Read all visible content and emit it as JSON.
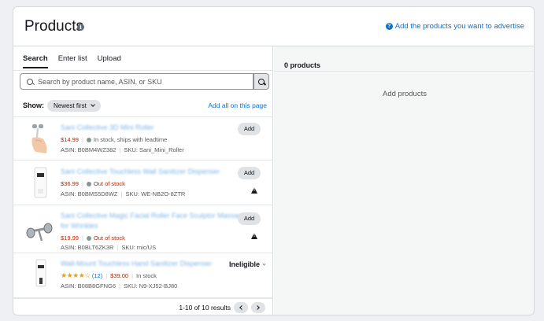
{
  "header": {
    "title": "Products",
    "help_link": "Add the products you want to advertise"
  },
  "tabs": [
    {
      "label": "Search",
      "active": true
    },
    {
      "label": "Enter list",
      "active": false
    },
    {
      "label": "Upload",
      "active": false
    }
  ],
  "search": {
    "placeholder": "Search by product name, ASIN, or SKU"
  },
  "filter": {
    "show_label": "Show:",
    "sort_value": "Newest first",
    "add_all": "Add all on this page"
  },
  "products": [
    {
      "name": "Sani Collective 3D Mini Roller",
      "price": "$14.99",
      "status": "In stock, ships with leadtime",
      "asin": "ASIN: B0BM4WZ382",
      "sku": "SKU: Sani_Mini_Roller",
      "action": "Add"
    },
    {
      "name": "Sani Collective Touchless Wall Sanitizer Dispenser",
      "price": "$36.99",
      "status": "Out of stock",
      "asin": "ASIN: B0BMS5D8WZ",
      "sku": "SKU: WE-NB2O-8ZTR",
      "action": "Add"
    },
    {
      "name": "Sani Collective Magic Facial Roller Face Sculptor Massage for Wrinkles",
      "price": "$19.99",
      "status": "Out of stock",
      "asin": "ASIN: B0BLT6ZK3R",
      "sku": "SKU: mic/US",
      "action": "Add"
    },
    {
      "name": "Wall-Mount Touchless Hand Sanitizer Dispenser",
      "rating_count": "(12)",
      "rating_value": 4.5,
      "price": "$39.00",
      "status": "In stock",
      "asin": "ASIN: B08B8GFNG6",
      "sku": "SKU: N9-XJ52-BJ80",
      "action": "Ineligible"
    }
  ],
  "pagination": {
    "results": "1-10 of 10 results"
  },
  "right_panel": {
    "count": "0 products",
    "empty_text": "Add products"
  },
  "colors": {
    "link": "#0972d3",
    "price": "#b12704",
    "star": "#ff9900"
  }
}
